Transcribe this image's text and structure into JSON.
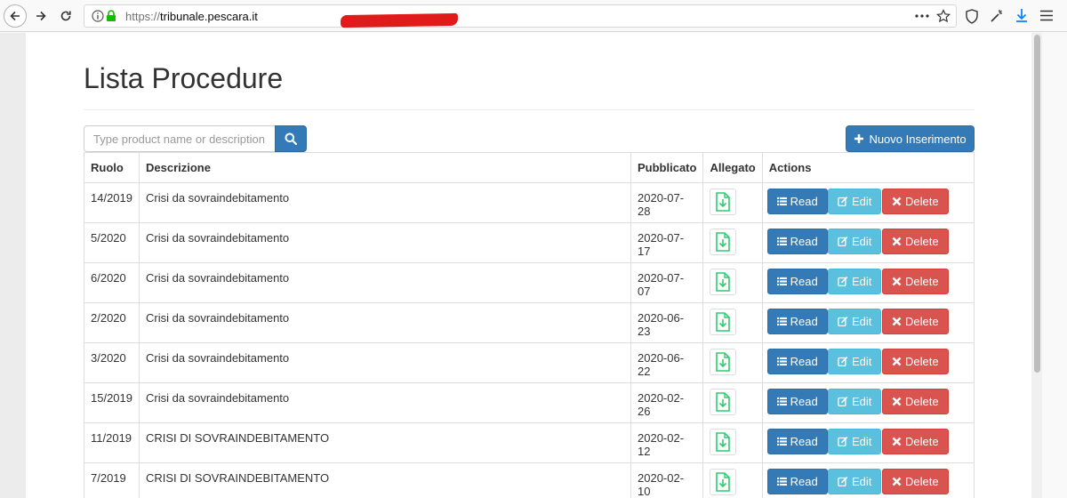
{
  "browser": {
    "url_scheme": "https://",
    "url_host": "tribunale.pescara.it"
  },
  "page": {
    "title": "Lista Procedure",
    "search_placeholder": "Type product name or description..",
    "new_button_label": "Nuovo Inserimento"
  },
  "table": {
    "headers": {
      "ruolo": "Ruolo",
      "descrizione": "Descrizione",
      "pubblicato": "Pubblicato",
      "allegato": "Allegato",
      "actions": "Actions"
    },
    "action_labels": {
      "read": "Read",
      "edit": "Edit",
      "delete": "Delete"
    },
    "rows": [
      {
        "ruolo": "14/2019",
        "descrizione": "Crisi da sovraindebitamento",
        "pubblicato": "2020-07-28"
      },
      {
        "ruolo": "5/2020",
        "descrizione": "Crisi da sovraindebitamento",
        "pubblicato": "2020-07-17"
      },
      {
        "ruolo": "6/2020",
        "descrizione": "Crisi da sovraindebitamento",
        "pubblicato": "2020-07-07"
      },
      {
        "ruolo": "2/2020",
        "descrizione": "Crisi da sovraindebitamento",
        "pubblicato": "2020-06-23"
      },
      {
        "ruolo": "3/2020",
        "descrizione": "Crisi da sovraindebitamento",
        "pubblicato": "2020-06-22"
      },
      {
        "ruolo": "15/2019",
        "descrizione": "Crisi da sovraindebitamento",
        "pubblicato": "2020-02-26"
      },
      {
        "ruolo": "11/2019",
        "descrizione": "CRISI DI SOVRAINDEBITAMENTO",
        "pubblicato": "2020-02-12"
      },
      {
        "ruolo": "7/2019",
        "descrizione": "CRISI DI SOVRAINDEBITAMENTO",
        "pubblicato": "2020-02-10"
      }
    ]
  },
  "colors": {
    "primary": "#337ab7",
    "info": "#5bc0de",
    "danger": "#d9534f",
    "attachment_icon": "#2ecc71"
  },
  "icons": [
    "back-arrow-icon",
    "forward-arrow-icon",
    "reload-icon",
    "info-icon",
    "lock-icon",
    "more-icon",
    "bookmark-star-icon",
    "shield-icon",
    "tracking-icon",
    "download-icon",
    "menu-icon",
    "search-icon",
    "plus-icon",
    "list-icon",
    "edit-icon",
    "delete-x-icon",
    "file-download-icon"
  ]
}
